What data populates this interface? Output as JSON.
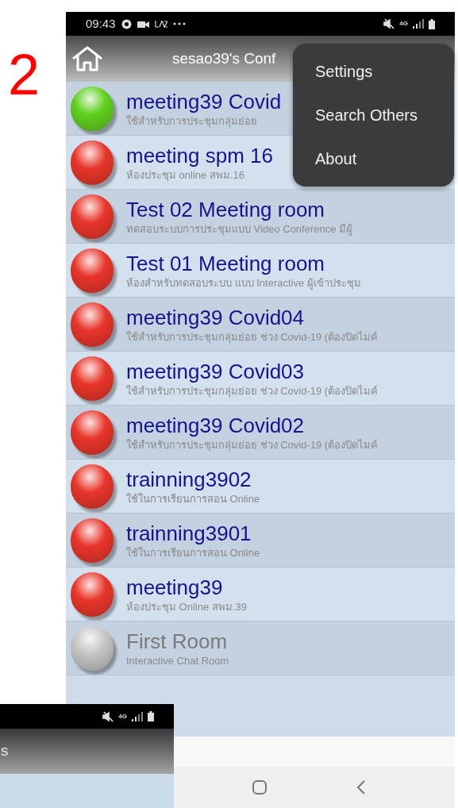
{
  "step_number": "2",
  "status_bar": {
    "time": "09:43",
    "network": "4G"
  },
  "header": {
    "title": "sesao39's Conf"
  },
  "menu": {
    "items": [
      "Settings",
      "Search Others",
      "About"
    ]
  },
  "rooms": [
    {
      "title": "meeting39 Covid",
      "subtitle": "ใช้สำหรับการประชุมกลุ่มย่อย",
      "color": "#5fd01e",
      "disabled": false
    },
    {
      "title": "meeting spm 16",
      "subtitle": "ห้องประชุม online สพม.16",
      "color": "#e8352a",
      "disabled": false
    },
    {
      "title": "Test 02 Meeting room",
      "subtitle": "ทดสอบระบบการประชุมแบบ Video Conference มีผู้",
      "color": "#e8352a",
      "disabled": false
    },
    {
      "title": "Test 01 Meeting room",
      "subtitle": "ห้องสำหรับทดสอบระบบ แบบ Interactive ผู้เข้าประชุม",
      "color": "#e8352a",
      "disabled": false
    },
    {
      "title": "meeting39 Covid04",
      "subtitle": "ใช้สำหรับการประชุมกลุ่มย่อย ช่วง Covid-19 (ต้องปิดไมค์",
      "color": "#e8352a",
      "disabled": false
    },
    {
      "title": "meeting39 Covid03",
      "subtitle": "ใช้สำหรับการประชุมกลุ่มย่อย ช่วง Covid-19 (ต้องปิดไมค์",
      "color": "#e8352a",
      "disabled": false
    },
    {
      "title": "meeting39 Covid02",
      "subtitle": "ใช้สำหรับการประชุมกลุ่มย่อย ช่วง Covid-19 (ต้องปิดไมค์",
      "color": "#e8352a",
      "disabled": false
    },
    {
      "title": "trainning3902",
      "subtitle": "ใช้ในการเรียนการสอน Online",
      "color": "#e8352a",
      "disabled": false
    },
    {
      "title": "trainning3901",
      "subtitle": "ใช้ในการเรียนการสอน Online",
      "color": "#e8352a",
      "disabled": false
    },
    {
      "title": "meeting39",
      "subtitle": "ห้องประชุม Online สพม.39",
      "color": "#e8352a",
      "disabled": false
    },
    {
      "title": "First Room",
      "subtitle": "Interactive Chat Room",
      "color": "#c4c4c4",
      "disabled": true
    }
  ],
  "second_screen": {
    "status_bar": {
      "network": "4G"
    },
    "header": {
      "title": "s"
    }
  }
}
